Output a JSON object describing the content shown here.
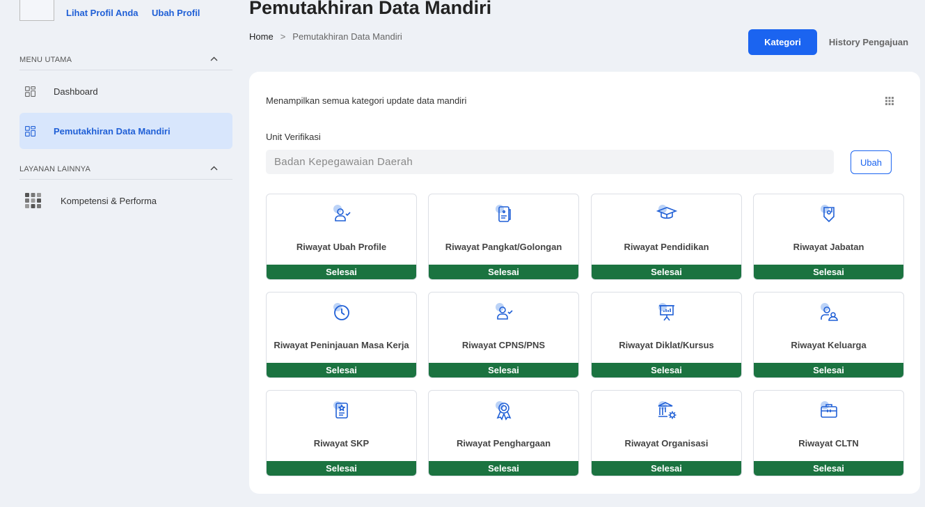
{
  "profile": {
    "view_label": "Lihat Profil Anda",
    "edit_label": "Ubah Profil"
  },
  "sidebar": {
    "sections": [
      {
        "title": "MENU UTAMA",
        "items": [
          {
            "label": "Dashboard",
            "icon": "dashboard-icon"
          },
          {
            "label": "Pemutakhiran Data Mandiri",
            "icon": "dashboard-icon",
            "active": true
          }
        ]
      },
      {
        "title": "LAYANAN LAINNYA",
        "items": [
          {
            "label": "Kompetensi & Performa",
            "icon": "apps-grid-icon"
          }
        ]
      }
    ]
  },
  "header": {
    "title": "Pemutakhiran Data Mandiri",
    "breadcrumb": {
      "home": "Home",
      "separator": ">",
      "current": "Pemutakhiran Data Mandiri"
    },
    "tabs": [
      {
        "label": "Kategori",
        "active": true
      },
      {
        "label": "History Pengajuan",
        "active": false
      }
    ]
  },
  "main": {
    "description": "Menampilkan semua kategori update data mandiri",
    "unit_label": "Unit Verifikasi",
    "unit_value": "Badan Kepegawaian Daerah",
    "change_button": "Ubah",
    "categories": [
      {
        "label": "Riwayat Ubah Profile",
        "status": "Selesai",
        "icon": "user-check-icon"
      },
      {
        "label": "Riwayat Pangkat/Golongan",
        "status": "Selesai",
        "icon": "id-card-icon"
      },
      {
        "label": "Riwayat Pendidikan",
        "status": "Selesai",
        "icon": "graduation-cap-icon"
      },
      {
        "label": "Riwayat Jabatan",
        "status": "Selesai",
        "icon": "badge-icon"
      },
      {
        "label": "Riwayat Peninjauan Masa Kerja",
        "status": "Selesai",
        "icon": "clock-icon"
      },
      {
        "label": "Riwayat CPNS/PNS",
        "status": "Selesai",
        "icon": "user-check-icon"
      },
      {
        "label": "Riwayat Diklat/Kursus",
        "status": "Selesai",
        "icon": "presentation-icon"
      },
      {
        "label": "Riwayat Keluarga",
        "status": "Selesai",
        "icon": "users-icon"
      },
      {
        "label": "Riwayat SKP",
        "status": "Selesai",
        "icon": "document-star-icon"
      },
      {
        "label": "Riwayat Penghargaan",
        "status": "Selesai",
        "icon": "award-icon"
      },
      {
        "label": "Riwayat Organisasi",
        "status": "Selesai",
        "icon": "building-gear-icon"
      },
      {
        "label": "Riwayat CLTN",
        "status": "Selesai",
        "icon": "briefcase-icon"
      }
    ]
  },
  "colors": {
    "primary": "#1b64f0",
    "status_done": "#1b7340",
    "active_nav_bg": "#d8e6fc",
    "icon_light": "#bcd3f7"
  }
}
